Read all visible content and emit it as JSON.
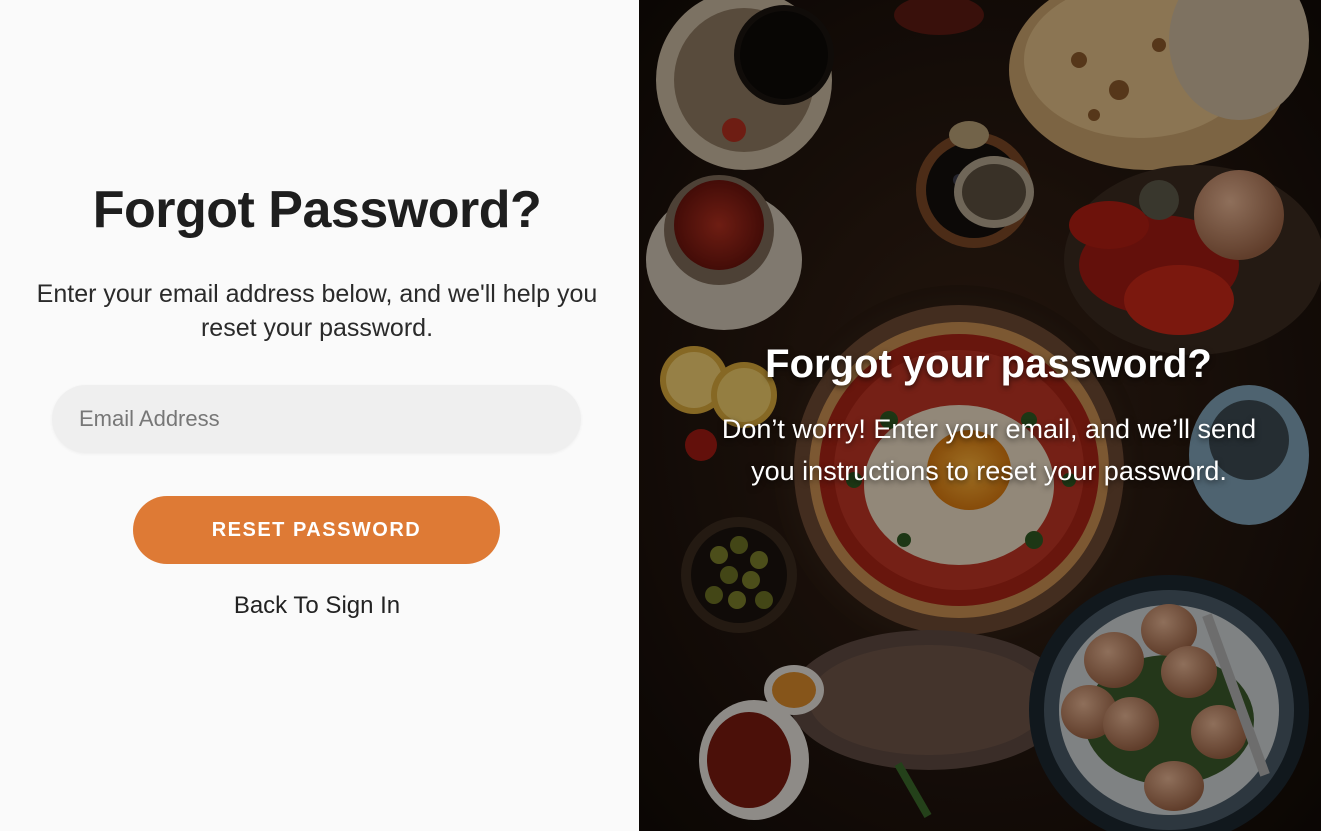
{
  "form": {
    "title": "Forgot Password?",
    "subtitle": "Enter your email address below, and we'll help you reset your password.",
    "email_placeholder": "Email Address",
    "email_value": "",
    "reset_button_label": "RESET PASSWORD",
    "back_link_label": "Back To Sign In"
  },
  "promo": {
    "title": "Forgot your password?",
    "text": "Don’t worry! Enter your email, and we’ll send you instructions to reset your password."
  },
  "colors": {
    "accent": "#de7a35",
    "left_background": "#fafafa",
    "input_background": "#efefef",
    "text_dark": "#1e1e1e"
  }
}
